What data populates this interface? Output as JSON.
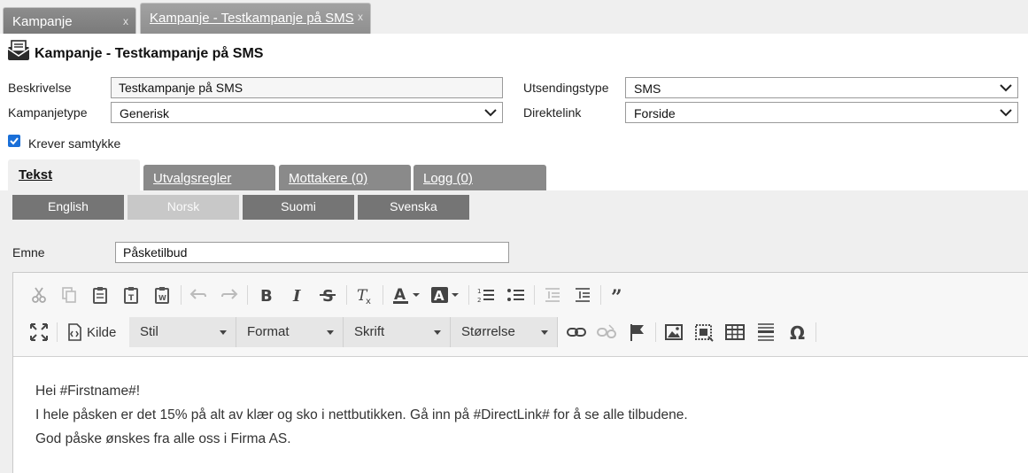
{
  "window_tabs": [
    {
      "label": "Kampanje",
      "close": "x"
    },
    {
      "label": "Kampanje - Testkampanje på SMS",
      "close": "x"
    }
  ],
  "page_title": "Kampanje - Testkampanje på SMS",
  "form": {
    "beskrivelse_label": "Beskrivelse",
    "beskrivelse_value": "Testkampanje på SMS",
    "kampanjetype_label": "Kampanjetype",
    "kampanjetype_value": "Generisk",
    "utsendingstype_label": "Utsendingstype",
    "utsendingstype_value": "SMS",
    "direktelink_label": "Direktelink",
    "direktelink_value": "Forside",
    "samtykke_label": "Krever samtykke",
    "samtykke_checked": true
  },
  "main_tabs": [
    {
      "label": "Tekst",
      "active": true
    },
    {
      "label": "Utvalgsregler"
    },
    {
      "label": "Mottakere (0)"
    },
    {
      "label": "Logg (0)"
    }
  ],
  "language_tabs": [
    {
      "label": "English"
    },
    {
      "label": "Norsk",
      "selected": true
    },
    {
      "label": "Suomi"
    },
    {
      "label": "Svenska"
    }
  ],
  "emne_label": "Emne",
  "emne_value": "Påsketilbud",
  "editor": {
    "source_label": "Kilde",
    "combos": [
      "Stil",
      "Format",
      "Skrift",
      "Størrelse"
    ],
    "lines": [
      "Hei #Firstname#!",
      "I hele påsken er det 15% på alt av klær og sko i nettbutikken. Gå inn på #DirectLink# for å se alle tilbudene.",
      "God påske ønskes fra alle oss i Firma AS."
    ]
  },
  "colors": {
    "checkbox": "#1a6fd8",
    "tab_gray": "#8a8a8a",
    "lang_tab": "#757575"
  }
}
